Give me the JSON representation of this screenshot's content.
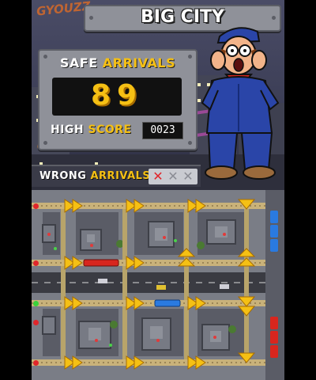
{
  "game": {
    "title": "BIG CITY",
    "graffiti_top": "GYOUZZ",
    "safe_label_1": "SAFE",
    "safe_label_2": "ARRIVALS",
    "safe_count": "89",
    "high_label_1": "HIGH",
    "high_label_2": "SCORE",
    "high_score": "0023",
    "wrong_label_1": "WRONG",
    "wrong_label_2": "ARRIVALS",
    "wrong_marks": [
      "✕",
      "✕",
      "✕"
    ],
    "wrong_mark_colors": [
      "#e0262b",
      "#9a9ca4",
      "#9a9ca4"
    ]
  },
  "colors": {
    "accent_yellow": "#f5c014",
    "panel_gray": "#9a9ca4",
    "display_black": "#111111",
    "sky": "#3b3d55"
  },
  "map": {
    "signals_left": [
      "red",
      "red",
      "green",
      "red",
      "red"
    ],
    "arrivals_right": [
      "blue-platform",
      "red-platform"
    ]
  }
}
